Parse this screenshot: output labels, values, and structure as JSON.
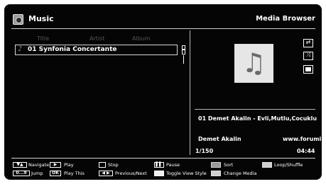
{
  "header": {
    "title": "Music",
    "subtitle": "Media Browser"
  },
  "columns": {
    "title": "Title",
    "artist": "Artist",
    "album": "Album"
  },
  "tracks": [
    {
      "label": "01 Synfonia Concertante"
    }
  ],
  "now_playing": {
    "title": "01 Demet Akalin - Evli,Mutlu,Cocuklu",
    "artist": "Demet Akalin",
    "website": "www.forumi...",
    "index": "1/150",
    "time": "04:44"
  },
  "icons": {
    "app": "music-app-icon",
    "track": "music-note-icon",
    "art": "music-note-icon",
    "repeat": "repeat-icon",
    "shuffle": "shuffle-icon",
    "stop": "stop-icon"
  },
  "footer": {
    "navigate": {
      "key": "▼▲",
      "label": "Navigate"
    },
    "jump": {
      "key": "0...9",
      "label": "Jump"
    },
    "play": {
      "key": "▶",
      "label": "Play"
    },
    "play_this": {
      "key": "OK",
      "label": "Play This"
    },
    "stop": {
      "label": "Stop"
    },
    "prev_next": {
      "key": "◀ ▶",
      "label": "Previous/Next"
    },
    "pause": {
      "key": "▌▌",
      "label": "Pause"
    },
    "toggle_view": {
      "label": "Toggle View Style"
    },
    "sort": {
      "label": "Sort"
    },
    "change_media": {
      "label": "Change Media"
    },
    "loop": {
      "label": "Loop/Shuffle"
    }
  }
}
